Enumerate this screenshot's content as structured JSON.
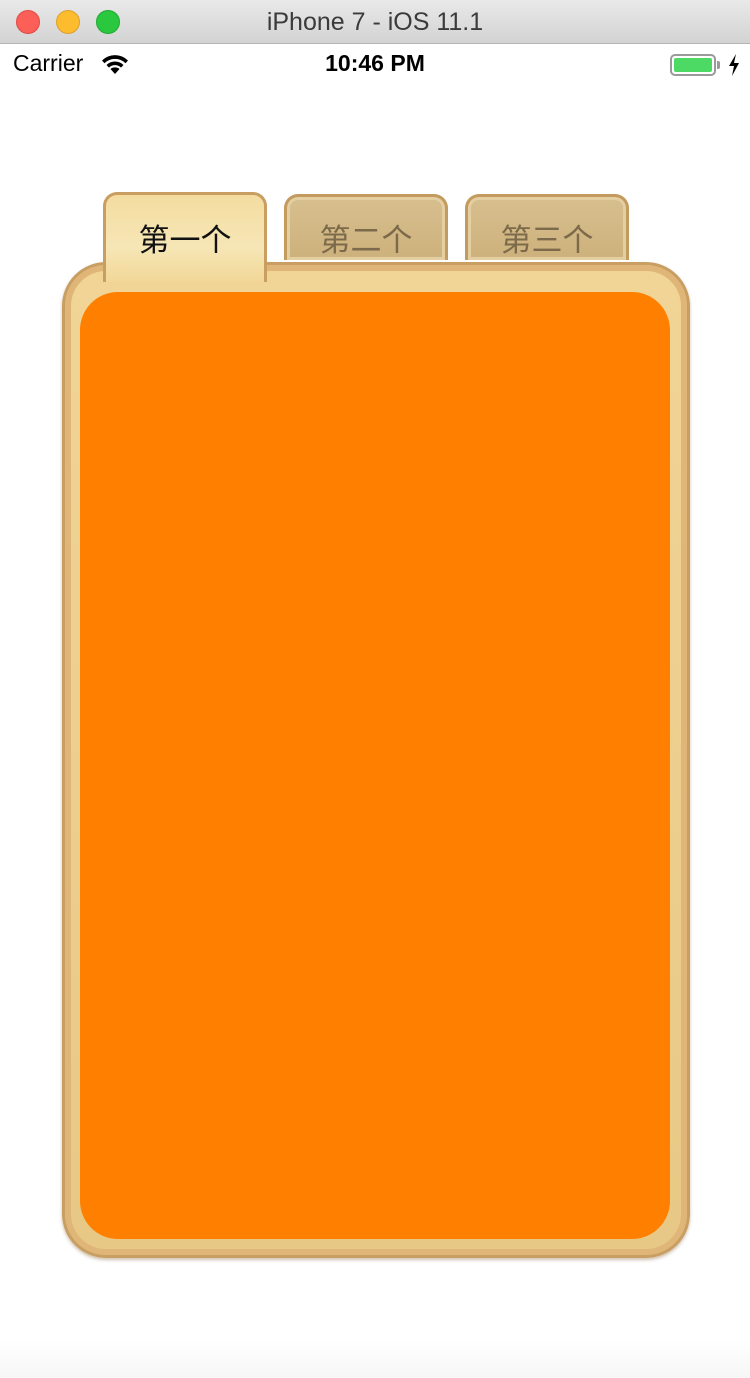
{
  "window": {
    "title": "iPhone 7 - iOS 11.1"
  },
  "status_bar": {
    "carrier": "Carrier",
    "time": "10:46 PM",
    "battery_color": "#4cd964"
  },
  "tabs": [
    {
      "label": "第一个",
      "selected": true
    },
    {
      "label": "第二个",
      "selected": false
    },
    {
      "label": "第三个",
      "selected": false
    }
  ],
  "content_panel": {
    "color": "#ff7f00"
  }
}
